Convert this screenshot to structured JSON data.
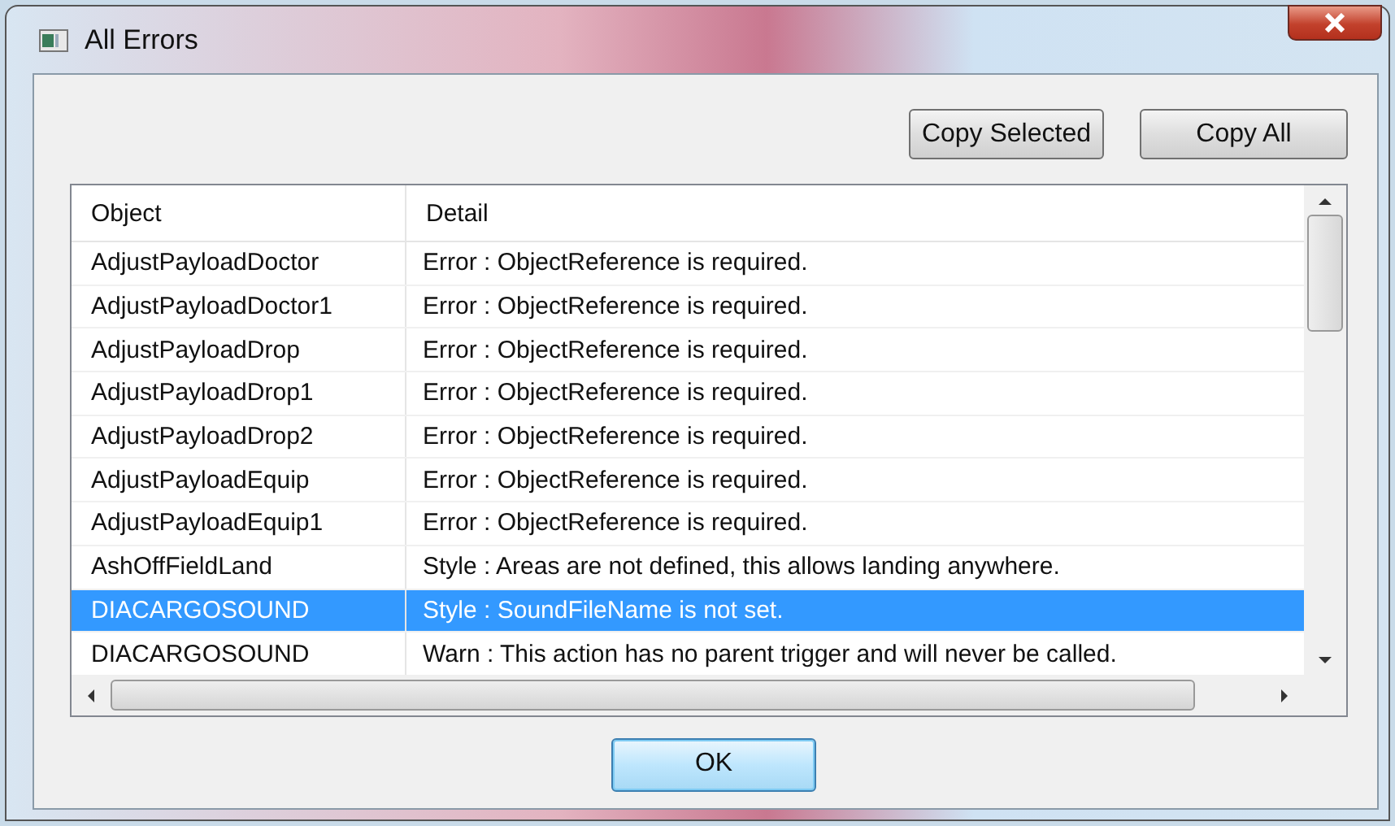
{
  "window": {
    "title": "All Errors"
  },
  "buttons": [
    {
      "label": "Copy Selected"
    },
    {
      "label": "Copy All"
    }
  ],
  "table": {
    "columns": [
      "Object",
      "Detail"
    ],
    "rows": [
      {
        "object": "AdjustPayloadDoctor",
        "detail": "Error : ObjectReference is required.",
        "selected": false
      },
      {
        "object": "AdjustPayloadDoctor1",
        "detail": "Error : ObjectReference is required.",
        "selected": false
      },
      {
        "object": "AdjustPayloadDrop",
        "detail": "Error : ObjectReference is required.",
        "selected": false
      },
      {
        "object": "AdjustPayloadDrop1",
        "detail": "Error : ObjectReference is required.",
        "selected": false
      },
      {
        "object": "AdjustPayloadDrop2",
        "detail": "Error : ObjectReference is required.",
        "selected": false
      },
      {
        "object": "AdjustPayloadEquip",
        "detail": "Error : ObjectReference is required.",
        "selected": false
      },
      {
        "object": "AdjustPayloadEquip1",
        "detail": "Error : ObjectReference is required.",
        "selected": false
      },
      {
        "object": "AshOffFieldLand",
        "detail": "Style : Areas are not defined, this allows landing anywhere.",
        "selected": false
      },
      {
        "object": "DIACARGOSOUND",
        "detail": "Style : SoundFileName is not set.",
        "selected": true
      },
      {
        "object": "DIACARGOSOUND",
        "detail": "Warn : This action has no parent trigger and will never be called.",
        "selected": false
      }
    ]
  },
  "ok_button": {
    "label": "OK"
  }
}
